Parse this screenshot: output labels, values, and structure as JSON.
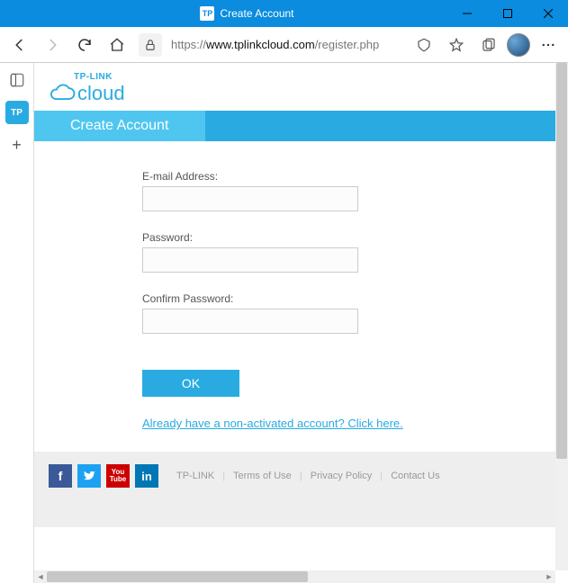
{
  "window": {
    "title": "Create Account",
    "favicon_text": "TP"
  },
  "toolbar": {
    "url_prefix": "https://",
    "url_domain": "www.tplinkcloud.com",
    "url_path": "/register.php"
  },
  "page": {
    "logo_top": "TP-LINK",
    "logo_text": "cloud",
    "banner_title": "Create Account",
    "form": {
      "email_label": "E-mail Address:",
      "password_label": "Password:",
      "confirm_label": "Confirm Password:",
      "ok_label": "OK",
      "alt_link": "Already have a non-activated account? Click here."
    },
    "footer": {
      "links": [
        "TP-LINK",
        "Terms of Use",
        "Privacy Policy",
        "Contact Us"
      ]
    }
  }
}
